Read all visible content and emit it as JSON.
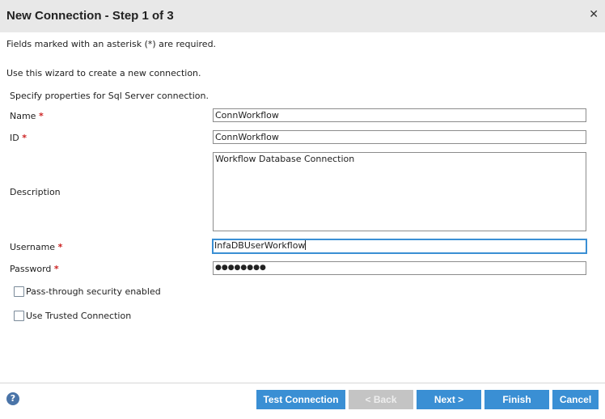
{
  "dialog": {
    "title": "New Connection - Step 1 of 3",
    "close_glyph": "✕"
  },
  "info": {
    "required_note": "Fields marked with an asterisk (*) are required.",
    "wizard_note": "Use this wizard to create a new connection.",
    "section_label": "Specify properties for Sql Server connection."
  },
  "form": {
    "name": {
      "label": "Name",
      "required": "*",
      "value": "ConnWorkflow"
    },
    "id": {
      "label": "ID",
      "required": "*",
      "value": "ConnWorkflow"
    },
    "description": {
      "label": "Description",
      "value": "Workflow Database Connection"
    },
    "username": {
      "label": "Username",
      "required": "*",
      "value": "InfaDBUserWorkflow"
    },
    "password": {
      "label": "Password",
      "required": "*",
      "value": "●●●●●●●●"
    },
    "passthrough": {
      "label": "Pass-through security enabled",
      "checked": false
    },
    "trusted": {
      "label": "Use Trusted Connection",
      "checked": false
    }
  },
  "footer": {
    "help_glyph": "?",
    "test_connection": "Test Connection",
    "back": "< Back",
    "next": "Next >",
    "finish": "Finish",
    "cancel": "Cancel"
  },
  "colors": {
    "accent": "#3a8fd4",
    "disabled": "#c4c4c4",
    "required": "#cc2222",
    "titlebar": "#e8e8e8"
  }
}
